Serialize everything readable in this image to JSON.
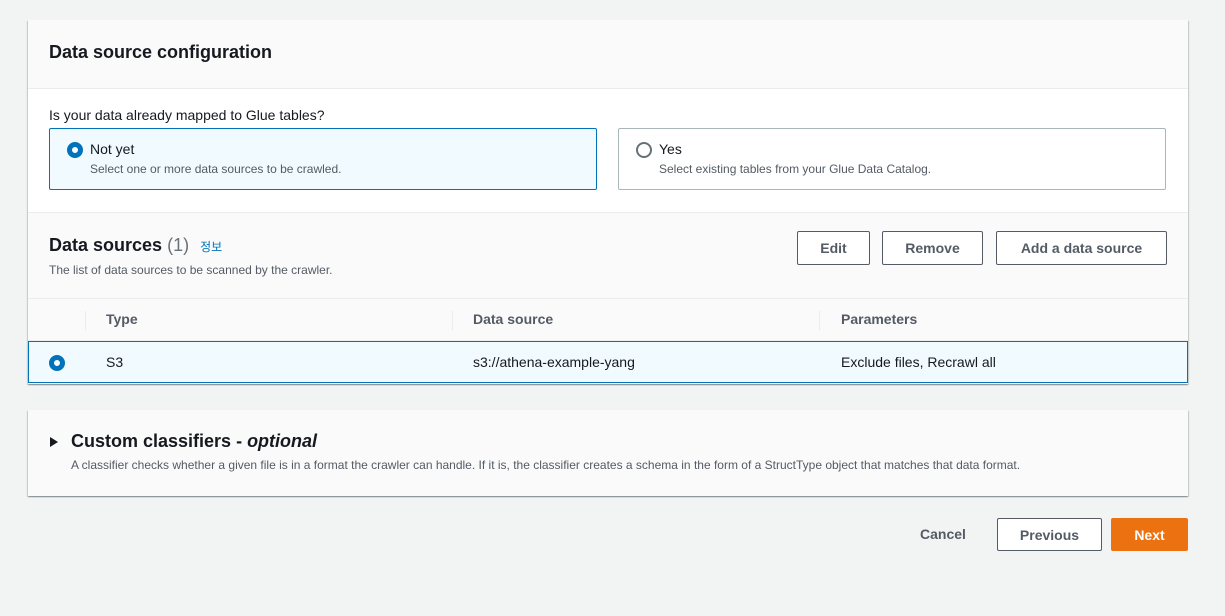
{
  "config": {
    "title": "Data source configuration",
    "question": "Is your data already mapped to Glue tables?",
    "options": [
      {
        "label": "Not yet",
        "description": "Select one or more data sources to be crawled.",
        "selected": true
      },
      {
        "label": "Yes",
        "description": "Select existing tables from your Glue Data Catalog.",
        "selected": false
      }
    ]
  },
  "data_sources": {
    "title": "Data sources",
    "count": "(1)",
    "info_link": "정보",
    "description": "The list of data sources to be scanned by the crawler.",
    "buttons": {
      "edit": "Edit",
      "remove": "Remove",
      "add": "Add a data source"
    },
    "columns": [
      "Type",
      "Data source",
      "Parameters"
    ],
    "rows": [
      {
        "type": "S3",
        "data_source": "s3://athena-example-yang",
        "parameters": "Exclude files, Recrawl all",
        "selected": true
      }
    ]
  },
  "classifiers": {
    "title": "Custom classifiers - ",
    "title_optional": "optional",
    "description": "A classifier checks whether a given file is in a format the crawler can handle. If it is, the classifier creates a schema in the form of a StructType object that matches that data format."
  },
  "footer": {
    "cancel": "Cancel",
    "previous": "Previous",
    "next": "Next"
  },
  "colors": {
    "accent": "#0073bb",
    "primary_button": "#ec7211",
    "background": "#f2f3f3"
  }
}
